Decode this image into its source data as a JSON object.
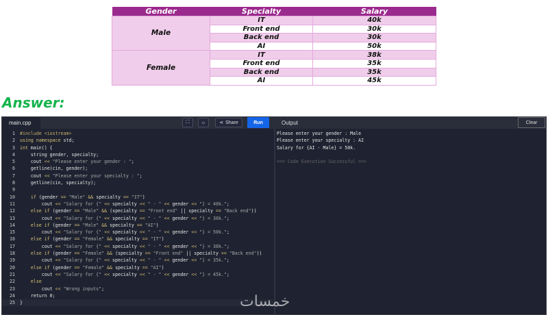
{
  "table": {
    "headers": [
      "Gender",
      "Specialty",
      "Salary"
    ],
    "groups": [
      {
        "gender": "Male",
        "rows": [
          [
            "IT",
            "40k"
          ],
          [
            "Front end",
            "30k"
          ],
          [
            "Back end",
            "30k"
          ],
          [
            "AI",
            "50k"
          ]
        ]
      },
      {
        "gender": "Female",
        "rows": [
          [
            "IT",
            "38k"
          ],
          [
            "Front end",
            "35k"
          ],
          [
            "Back end",
            "35k"
          ],
          [
            "AI",
            "45k"
          ]
        ]
      }
    ],
    "header_color": "#9b2a8e",
    "accent_bg": "#f0cdea"
  },
  "answer_label": "Answer:",
  "editor": {
    "tab": "main.cpp",
    "share": "Share",
    "run": "Run",
    "output_label": "Output",
    "clear": "Clear",
    "run_color": "#1565e8",
    "code": [
      "#include <iostream>",
      "using namespace std;",
      "int main() {",
      "    string gender, specialty;",
      "    cout << \"Please enter your gender : \";",
      "    getline(cin, gender);",
      "    cout << \"Please enter your specialty : \";",
      "    getline(cin, specialty);",
      "",
      "    if (gender == \"Male\" && specialty == \"IT\")",
      "        cout << \"Salary for {\" << specialty << \" - \" << gender << \"} = 40k.\";",
      "    else if (gender == \"Male\" && (specialty == \"Front end\" || specialty == \"Back end\"))",
      "        cout << \"Salary for {\" << specialty << \" - \" << gender << \"} = 30k.\";",
      "    else if (gender == \"Male\" && specialty == \"AI\")",
      "        cout << \"Salary for {\" << specialty << \" - \" << gender << \"} = 50k.\";",
      "    else if (gender == \"Female\" && specialty == \"IT\")",
      "        cout << \"Salary for {\" << specialty << \" - \" << gender << \"} = 38k.\";",
      "    else if (gender == \"Female\" && (specialty == \"Front end\" || specialty == \"Back end\"))",
      "        cout << \"Salary for {\" << specialty << \" - \" << gender << \"} = 35k.\";",
      "    else if (gender == \"Female\" && specialty == \"AI\")",
      "        cout << \"Salary for {\" << specialty << \" - \" << gender << \"} = 45k.\";",
      "    else",
      "        cout << \"Wrong inputs\";",
      "    return 0;",
      "}"
    ],
    "output": [
      "Please enter your gender : Male",
      "Please enter your specialty : AI",
      "Salary for {AI - Male} = 50k.",
      "",
      "=== Code Execution Successful ==="
    ]
  },
  "watermark": "خمسات"
}
